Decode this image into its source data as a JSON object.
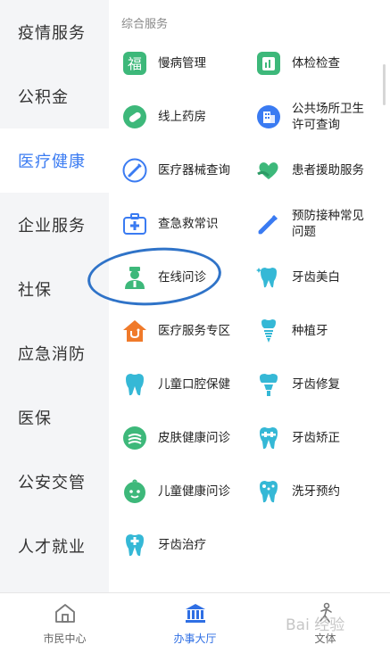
{
  "sidebar": {
    "items": [
      {
        "label": "疫情服务"
      },
      {
        "label": "公积金"
      },
      {
        "label": "医疗健康",
        "active": true
      },
      {
        "label": "企业服务"
      },
      {
        "label": "社保"
      },
      {
        "label": "应急消防"
      },
      {
        "label": "医保"
      },
      {
        "label": "公安交管"
      },
      {
        "label": "人才就业"
      }
    ]
  },
  "content": {
    "section_title": "综合服务",
    "services": [
      {
        "label": "慢病管理",
        "icon": "chronic-disease-icon"
      },
      {
        "label": "体检检查",
        "icon": "physical-exam-icon"
      },
      {
        "label": "线上药房",
        "icon": "pill-icon"
      },
      {
        "label": "公共场所卫生许可查询",
        "icon": "building-icon"
      },
      {
        "label": "医疗器械查询",
        "icon": "syringe-icon"
      },
      {
        "label": "患者援助服务",
        "icon": "heart-hand-icon"
      },
      {
        "label": "查急救常识",
        "icon": "first-aid-kit-icon"
      },
      {
        "label": "预防接种常见问题",
        "icon": "vaccine-icon"
      },
      {
        "label": "在线问诊",
        "icon": "doctor-icon"
      },
      {
        "label": "牙齿美白",
        "icon": "tooth-sparkle-icon"
      },
      {
        "label": "医疗服务专区",
        "icon": "home-stethoscope-icon"
      },
      {
        "label": "种植牙",
        "icon": "tooth-implant-icon"
      },
      {
        "label": "儿童口腔保健",
        "icon": "tooth-icon"
      },
      {
        "label": "牙齿修复",
        "icon": "tooth-repair-icon"
      },
      {
        "label": "皮肤健康问诊",
        "icon": "skin-icon"
      },
      {
        "label": "牙齿矫正",
        "icon": "tooth-braces-icon"
      },
      {
        "label": "儿童健康问诊",
        "icon": "baby-face-icon"
      },
      {
        "label": "洗牙预约",
        "icon": "tooth-clean-icon"
      },
      {
        "label": "牙齿治疗",
        "icon": "tooth-treatment-icon"
      }
    ]
  },
  "tabbar": {
    "tabs": [
      {
        "label": "市民中心",
        "icon": "home-icon"
      },
      {
        "label": "办事大厅",
        "icon": "government-hall-icon",
        "active": true
      },
      {
        "label": "文体",
        "icon": "sports-culture-icon"
      }
    ]
  },
  "watermark": "Bai 经验",
  "colors": {
    "accent": "#3a7bf2",
    "green": "#3db87a",
    "teal": "#35b8d6",
    "orange": "#f07a2a",
    "annotation": "#2f73c8"
  }
}
